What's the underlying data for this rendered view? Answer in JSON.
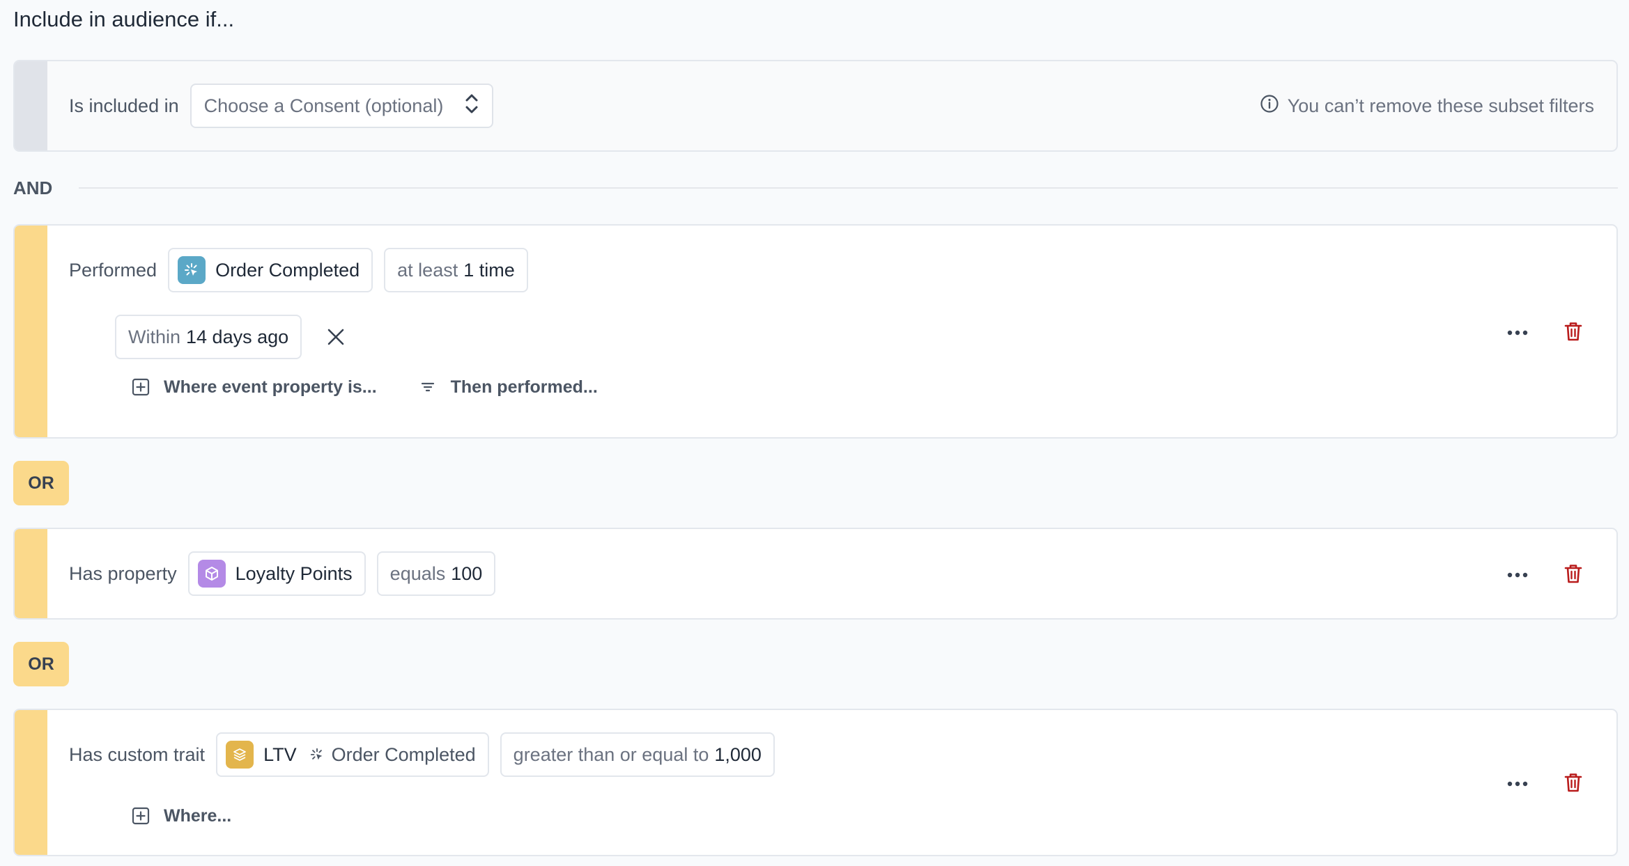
{
  "title": "Include in audience if...",
  "subset": {
    "label": "Is included in",
    "select_placeholder": "Choose a Consent (optional)",
    "note": "You can’t remove these subset filters"
  },
  "and_label": "AND",
  "or_label": "OR",
  "conditions": [
    {
      "label": "Performed",
      "event": "Order Completed",
      "frequency_prefix": "at least",
      "frequency_value": "1 time",
      "window_prefix": "Within",
      "window_value": "14 days ago",
      "action_1": "Where event property is...",
      "action_2": "Then performed..."
    },
    {
      "label": "Has property",
      "property": "Loyalty Points",
      "operator": "equals",
      "value": "100"
    },
    {
      "label": "Has custom trait",
      "trait": "LTV",
      "trait_source": "Order Completed",
      "operator": "greater than or equal to",
      "value": "1,000",
      "action_1": "Where..."
    }
  ],
  "colors": {
    "accent_stripe": "#fbd98b",
    "event_icon_bg": "#5ba8c7",
    "property_icon_bg": "#b48ae6",
    "trait_icon_bg": "#e3b54c",
    "delete_red": "#b91c1c"
  }
}
